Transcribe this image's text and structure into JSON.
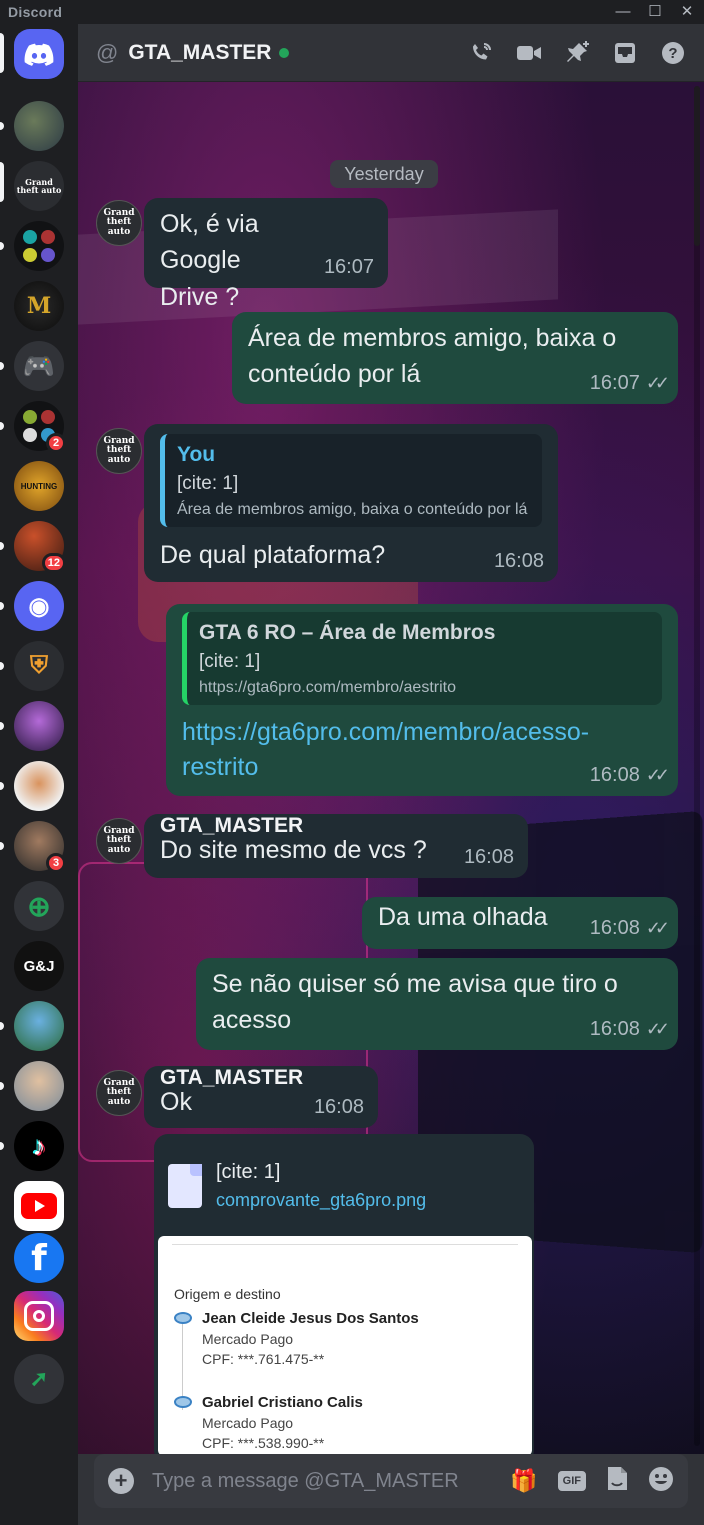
{
  "titlebar": {
    "title": "Discord"
  },
  "header": {
    "at_symbol": "@",
    "username": "GTA_MASTER"
  },
  "day_divider": "Yesterday",
  "badges": {
    "b1": "2",
    "b2": "12",
    "b3": "3"
  },
  "server_labels": {
    "grand_theft": "Grand theft auto",
    "hunting": "HUNTING",
    "gaj": "G&J"
  },
  "messages": {
    "m1": {
      "text": "Ok, é via Google Drive ?",
      "time": "16:07"
    },
    "m2": {
      "text": "Área de membros amigo, baixa o conteúdo por lá",
      "time": "16:07"
    },
    "m3": {
      "quote_author": "You",
      "quote_cite": "[cite: 1]",
      "quote_text": "Área de membros amigo, baixa o conteúdo por lá",
      "text": "De qual plataforma?",
      "time": "16:08"
    },
    "m4": {
      "preview_title": "GTA 6 RO – Área de Membros",
      "preview_cite": "[cite: 1]",
      "preview_url": "https://gta6pro.com/membro/aestrito",
      "link": "https://gta6pro.com/membro/acesso-restrito",
      "time": "16:08"
    },
    "m5": {
      "sender": "GTA_MASTER",
      "text": "Do site mesmo de vcs ?",
      "time": "16:08"
    },
    "m6": {
      "text": "Da uma olhada",
      "time": "16:08"
    },
    "m7": {
      "text": "Se não quiser só me avisa que tiro o acesso",
      "time": "16:08"
    },
    "m8": {
      "sender": "GTA_MASTER",
      "text": "Ok",
      "time": "16:08"
    },
    "m9": {
      "file_cite": "[cite: 1]",
      "file_name": "comprovante_gta6pro.png",
      "receipt": {
        "section": "Origem e destino",
        "from_name": "Jean Cleide Jesus Dos Santos",
        "from_bank": "Mercado Pago",
        "from_cpf": "CPF: ***.761.475-**",
        "to_name": "Gabriel Cristiano Calis",
        "to_bank": "Mercado Pago",
        "to_cpf": "CPF: ***.538.990-**"
      }
    }
  },
  "composer": {
    "placeholder": "Type a message @GTA_MASTER"
  },
  "colors": {
    "accent_online": "#23a55a",
    "outgoing_bubble": "#1f4a3e",
    "incoming_bubble": "#202c33",
    "badge_red": "#f23f43",
    "discord_blurple": "#5865f2"
  }
}
